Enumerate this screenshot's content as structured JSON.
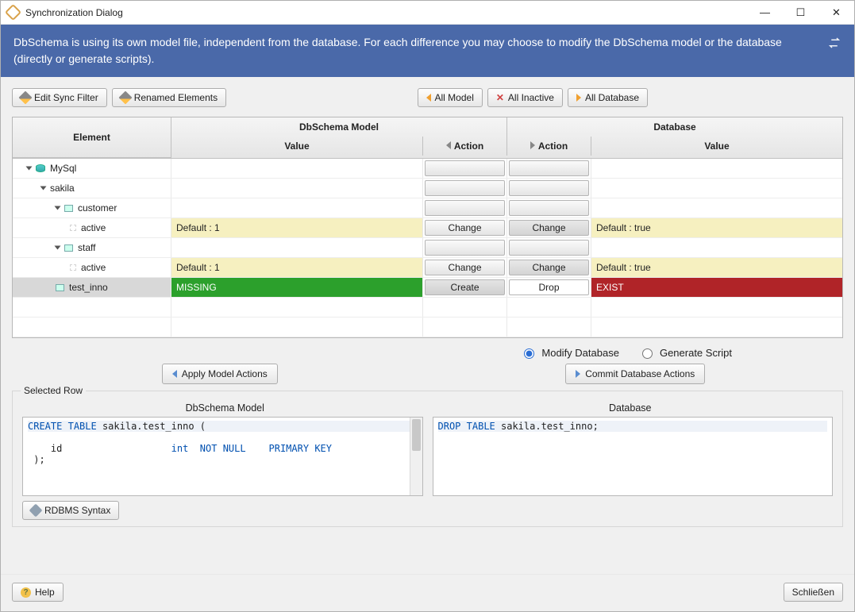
{
  "window": {
    "title": "Synchronization Dialog"
  },
  "banner": {
    "text": "DbSchema is using its own model file, independent from the database. For each difference you may choose to modify the DbSchema model or the database (directly or generate scripts)."
  },
  "toolbar": {
    "edit_sync_filter": "Edit Sync Filter",
    "renamed_elements": "Renamed Elements",
    "all_model": "All Model",
    "all_inactive": "All Inactive",
    "all_database": "All Database"
  },
  "tree_headers": {
    "element": "Element",
    "dbschema_model": "DbSchema Model",
    "database": "Database",
    "value": "Value",
    "action_l": "Action",
    "action_r": "Action"
  },
  "rows": {
    "r0": {
      "label": "MySql"
    },
    "r1": {
      "label": "sakila"
    },
    "r2": {
      "label": "customer"
    },
    "r3": {
      "label": "active",
      "model_val": "Default : 1",
      "act_l": "Change",
      "act_r": "Change",
      "db_val": "Default : true"
    },
    "r4": {
      "label": "staff"
    },
    "r5": {
      "label": "active",
      "model_val": "Default : 1",
      "act_l": "Change",
      "act_r": "Change",
      "db_val": "Default : true"
    },
    "r6": {
      "label": "test_inno",
      "model_val": "MISSING",
      "act_l": "Create",
      "act_r": "Drop",
      "db_val": "EXIST"
    }
  },
  "radios": {
    "modify_db": "Modify Database",
    "gen_script": "Generate Script"
  },
  "action_buttons": {
    "apply_model": "Apply Model Actions",
    "commit_db": "Commit Database Actions"
  },
  "selected_row": {
    "legend": "Selected Row",
    "model_head": "DbSchema Model",
    "db_head": "Database",
    "model_sql_l1": "CREATE TABLE sakila.test_inno ( ",
    "model_sql_l2": "    id                   int  NOT NULL    PRIMARY KEY",
    "model_sql_l3": " );",
    "db_sql_l1": "DROP TABLE sakila.test_inno;"
  },
  "rdbms_btn": "RDBMS Syntax",
  "footer": {
    "help": "Help",
    "close": "Schließen"
  }
}
